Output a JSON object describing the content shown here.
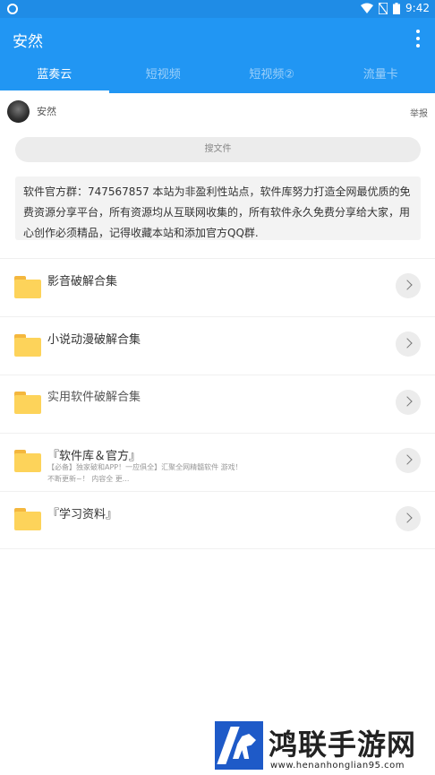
{
  "status_bar": {
    "time": "9:42"
  },
  "app": {
    "title": "安然"
  },
  "tabs": [
    {
      "label": "蓝奏云"
    },
    {
      "label": "短视频"
    },
    {
      "label": "短视频②"
    },
    {
      "label": "流量卡"
    }
  ],
  "author": {
    "name": "安然",
    "report_label": "举报"
  },
  "search": {
    "placeholder": "搜文件"
  },
  "notice": {
    "text": "软件官方群：747567857 本站为非盈利性站点，软件库努力打造全网最优质的免费资源分享平台，所有资源均从互联网收集的，所有软件永久免费分享给大家，用心创作必须精品，记得收藏本站和添加官方QQ群."
  },
  "folders": [
    {
      "title": "影音破解合集",
      "subtitle": ""
    },
    {
      "title": "小说动漫破解合集",
      "subtitle": ""
    },
    {
      "title": "实用软件破解合集",
      "subtitle": ""
    },
    {
      "title": "『软件库＆官方』",
      "subtitle": "【必备】独家破和APP！一应俱全】汇聚全网精髓软件 游戏！不断更新~！ 内容全 更..."
    },
    {
      "title": "『学习资料』",
      "subtitle": ""
    }
  ],
  "watermark": {
    "title": "鸿联手游网",
    "url": "www.henanhonglian95.com"
  }
}
